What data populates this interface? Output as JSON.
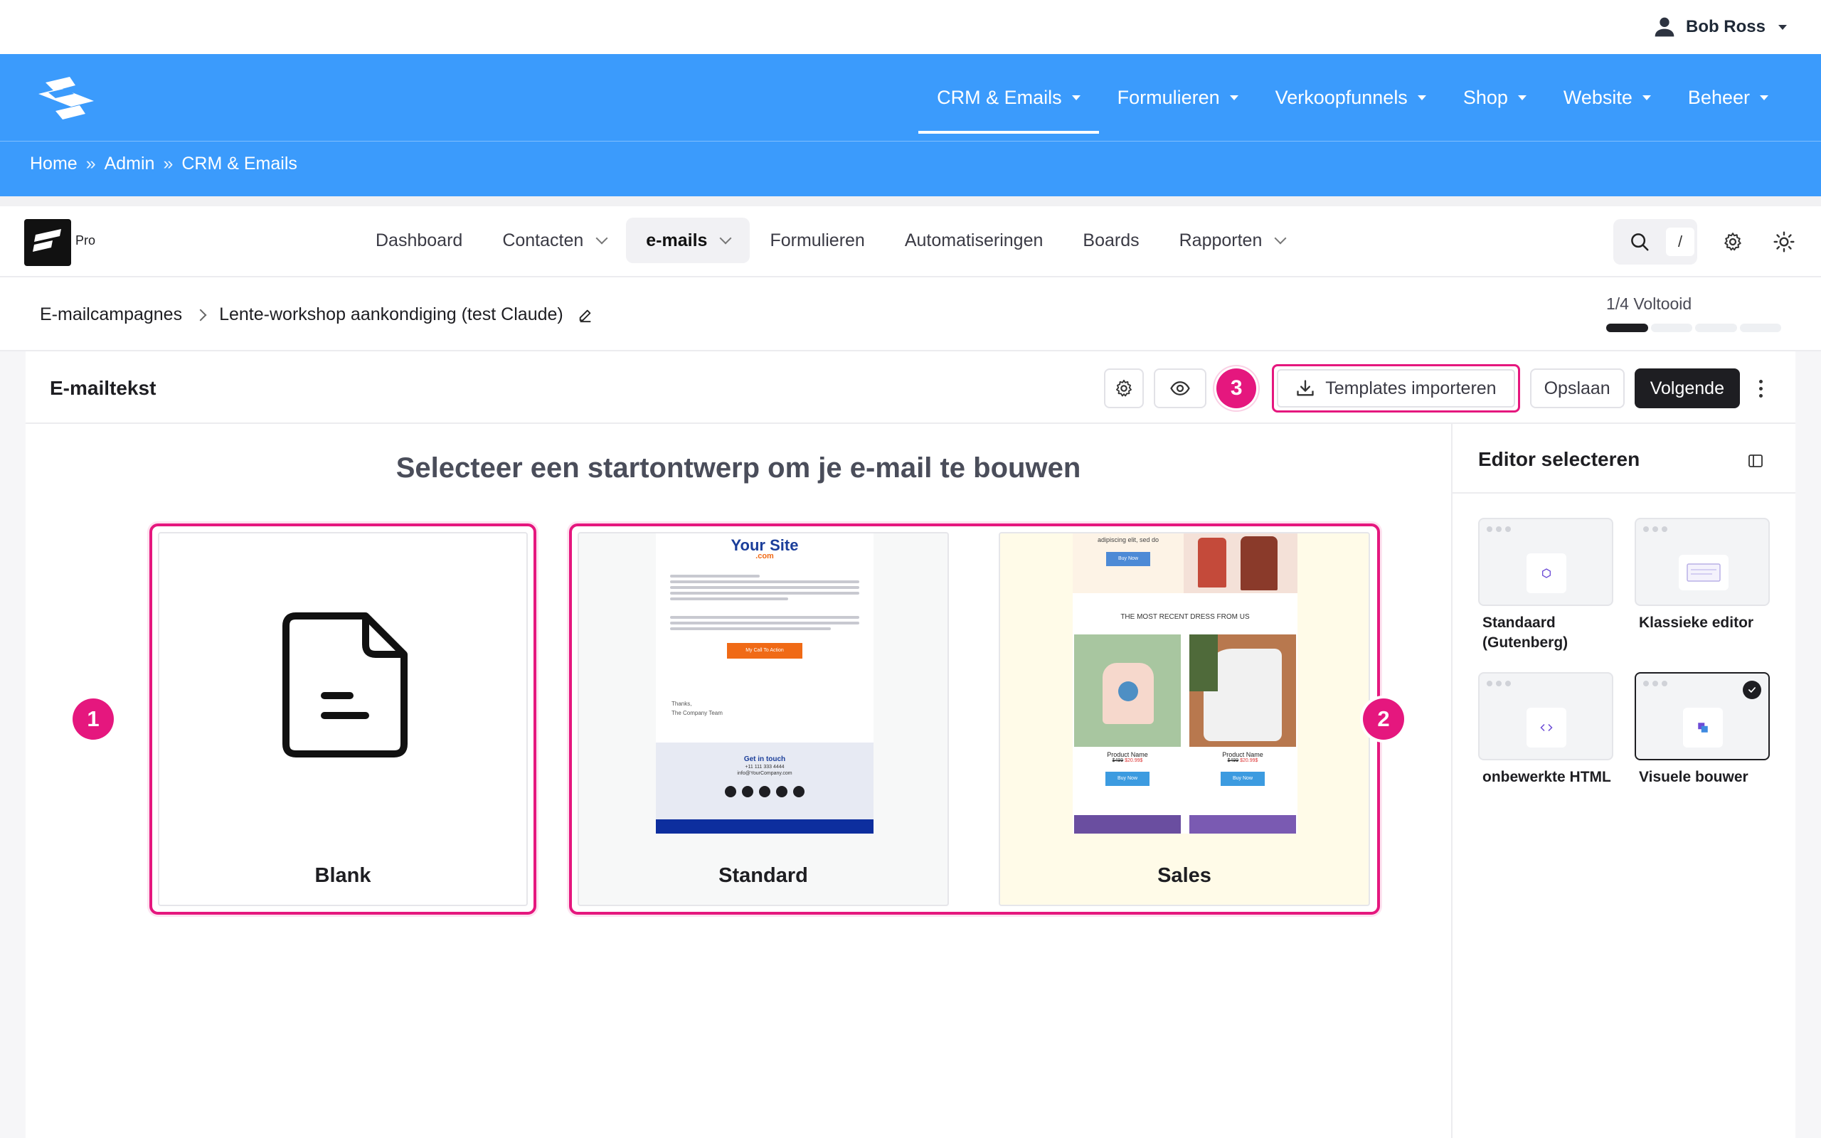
{
  "user": {
    "name": "Bob Ross"
  },
  "main_nav": [
    {
      "label": "CRM & Emails",
      "active": true
    },
    {
      "label": "Formulieren"
    },
    {
      "label": "Verkoopfunnels"
    },
    {
      "label": "Shop"
    },
    {
      "label": "Website"
    },
    {
      "label": "Beheer"
    }
  ],
  "breadcrumb": [
    "Home",
    "Admin",
    "CRM & Emails"
  ],
  "breadcrumb_sep": "»",
  "app": {
    "plan": "Pro",
    "tabs": [
      {
        "label": "Dashboard"
      },
      {
        "label": "Contacten",
        "dropdown": true
      },
      {
        "label": "e-mails",
        "dropdown": true,
        "active": true
      },
      {
        "label": "Formulieren"
      },
      {
        "label": "Automatiseringen"
      },
      {
        "label": "Boards"
      },
      {
        "label": "Rapporten",
        "dropdown": true
      }
    ],
    "search_shortcut": "/"
  },
  "campaign": {
    "parent": "E-mailcampagnes",
    "name": "Lente-workshop aankondiging (test Claude)",
    "progress_label": "1/4 Voltooid",
    "progress_done": 1,
    "progress_total": 4
  },
  "toolbar": {
    "title": "E-mailtekst",
    "import_label": "Templates importeren",
    "save_label": "Opslaan",
    "next_label": "Volgende",
    "annotation_3": "3"
  },
  "canvas": {
    "heading": "Selecteer een startontwerp om je e-mail te bouwen",
    "annotation_1": "1",
    "annotation_2": "2",
    "templates": [
      {
        "label": "Blank"
      },
      {
        "label": "Standard"
      },
      {
        "label": "Sales"
      }
    ],
    "standard_preview": {
      "brand": "Your Site",
      "brand_suffix": ".com",
      "cta": "My Call To Action",
      "footer_title": "Get in touch",
      "footer_phone": "+11 111 333 4444",
      "footer_email": "info@YourCompany.com",
      "sign": "Thanks,",
      "signature": "The Company Team"
    },
    "sales_preview": {
      "intro": "adipiscing elit, sed do",
      "buy": "Buy Now",
      "headline": "THE MOST RECENT DRESS FROM US",
      "products": [
        {
          "name": "Product Name",
          "old": "$499",
          "price": "$20.99$"
        },
        {
          "name": "Product Name",
          "old": "$499",
          "price": "$20.99$"
        }
      ]
    }
  },
  "editor_panel": {
    "title": "Editor selecteren",
    "editors": [
      {
        "label": "Standaard (Gutenberg)"
      },
      {
        "label": "Klassieke editor"
      },
      {
        "label": "onbewerkte HTML"
      },
      {
        "label": "Visuele bouwer",
        "selected": true
      }
    ]
  },
  "colors": {
    "brand_blue": "#3b9bfc",
    "highlight_pink": "#e5177e",
    "dark": "#1e1e22"
  }
}
